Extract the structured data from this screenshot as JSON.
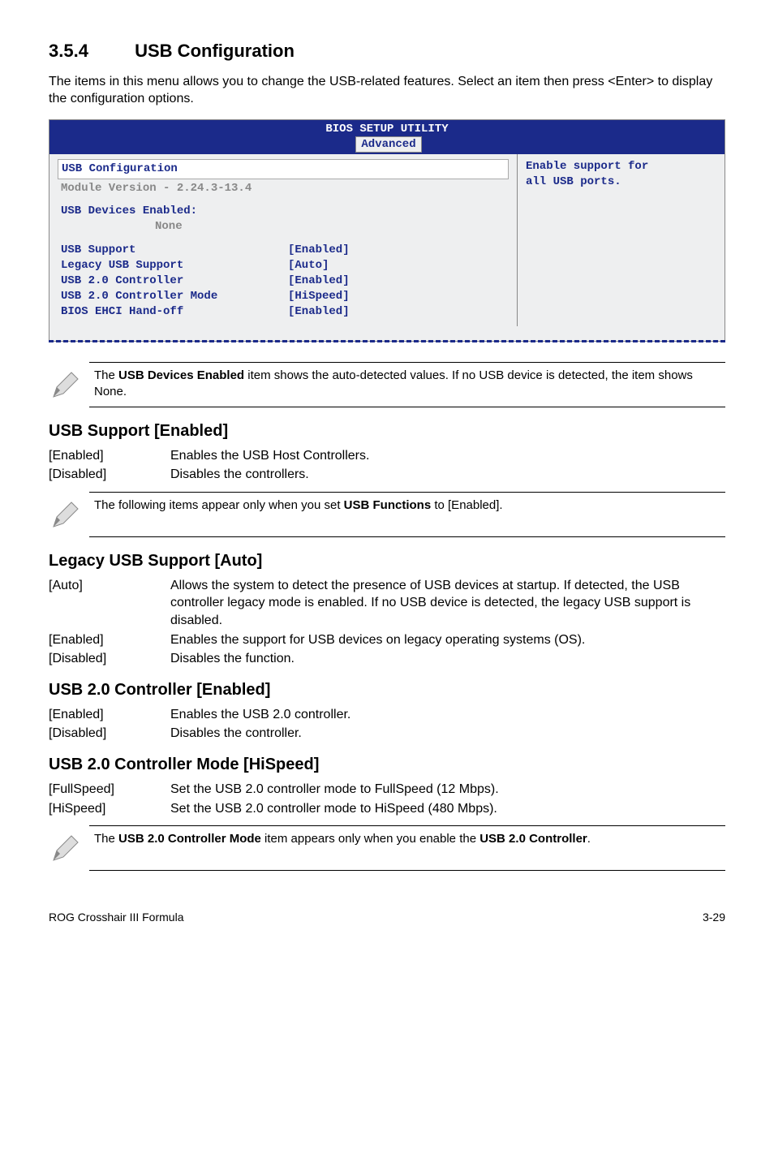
{
  "section": {
    "number": "3.5.4",
    "title": "USB Configuration"
  },
  "intro": "The items in this menu allows you to change the USB-related features. Select an item then press <Enter> to display the configuration options.",
  "bios": {
    "title": "BIOS SETUP UTILITY",
    "tab": "Advanced",
    "box_title": "USB Configuration",
    "module_version": "Module Version - 2.24.3-13.4",
    "devices_label": "USB Devices Enabled:",
    "devices_value": "None",
    "rows": [
      {
        "k": "USB Support",
        "v": "[Enabled]"
      },
      {
        "k": "Legacy USB Support",
        "v": "[Auto]"
      },
      {
        "k": "USB 2.0 Controller",
        "v": "[Enabled]"
      },
      {
        "k": "USB 2.0 Controller Mode",
        "v": "[HiSpeed]"
      },
      {
        "k": "BIOS EHCI Hand-off",
        "v": "[Enabled]"
      }
    ],
    "help1": "Enable support for",
    "help2": "all USB ports."
  },
  "notes": {
    "n1a": "The ",
    "n1b": "USB Devices Enabled",
    "n1c": " item shows the auto-detected values. If no USB device is detected, the item shows None.",
    "n2a": "The following items appear only when you set ",
    "n2b": "USB Functions",
    "n2c": " to [Enabled].",
    "n3a": "The ",
    "n3b": "USB 2.0 Controller Mode",
    "n3c": " item appears only when you enable the ",
    "n3d": "USB 2.0 Controller",
    "n3e": "."
  },
  "usb_support": {
    "heading": "USB Support [Enabled]",
    "rows": [
      {
        "k": "[Enabled]",
        "v": "Enables the USB Host Controllers."
      },
      {
        "k": "[Disabled]",
        "v": "Disables the controllers."
      }
    ]
  },
  "legacy": {
    "heading": "Legacy USB Support [Auto]",
    "rows": [
      {
        "k": "[Auto]",
        "v": "Allows the system to detect the presence of USB devices at startup. If detected, the USB controller legacy mode is enabled. If no USB device is detected, the legacy USB support is disabled."
      },
      {
        "k": "[Enabled]",
        "v": "Enables the support for USB devices on legacy operating systems (OS)."
      },
      {
        "k": "[Disabled]",
        "v": "Disables the function."
      }
    ]
  },
  "usb20": {
    "heading": "USB 2.0 Controller [Enabled]",
    "rows": [
      {
        "k": "[Enabled]",
        "v": "Enables the USB 2.0 controller."
      },
      {
        "k": "[Disabled]",
        "v": "Disables the controller."
      }
    ]
  },
  "usb20mode": {
    "heading": "USB 2.0 Controller Mode [HiSpeed]",
    "rows": [
      {
        "k": "[FullSpeed]",
        "v": "Set the USB 2.0 controller mode to FullSpeed (12 Mbps)."
      },
      {
        "k": "[HiSpeed]",
        "v": "Set the USB 2.0 controller mode to HiSpeed (480 Mbps)."
      }
    ]
  },
  "footer": {
    "left": "ROG Crosshair III Formula",
    "right": "3-29"
  }
}
